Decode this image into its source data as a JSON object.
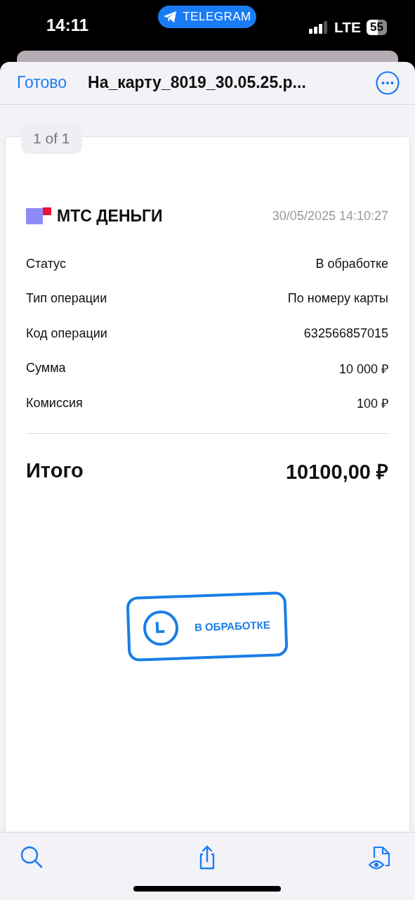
{
  "status_bar": {
    "time": "14:11",
    "app_pill": "TELEGRAM",
    "network": "LTE",
    "battery": "55"
  },
  "header": {
    "done": "Готово",
    "title": "На_карту_8019_30.05.25.p..."
  },
  "page_badge": "1 of 1",
  "receipt": {
    "brand": "МТС ДЕНЬГИ",
    "datetime": "30/05/2025 14:10:27",
    "rows": [
      {
        "label": "Статус",
        "value": "В обработке"
      },
      {
        "label": "Тип операции",
        "value": "По номеру карты"
      },
      {
        "label": "Код операции",
        "value": "632566857015"
      },
      {
        "label": "Сумма",
        "value": "10 000 ₽"
      },
      {
        "label": "Комиссия",
        "value": "100 ₽"
      }
    ],
    "total_label": "Итого",
    "total_value": "10100,00 ₽",
    "stamp": "В ОБРАБОТКЕ"
  }
}
